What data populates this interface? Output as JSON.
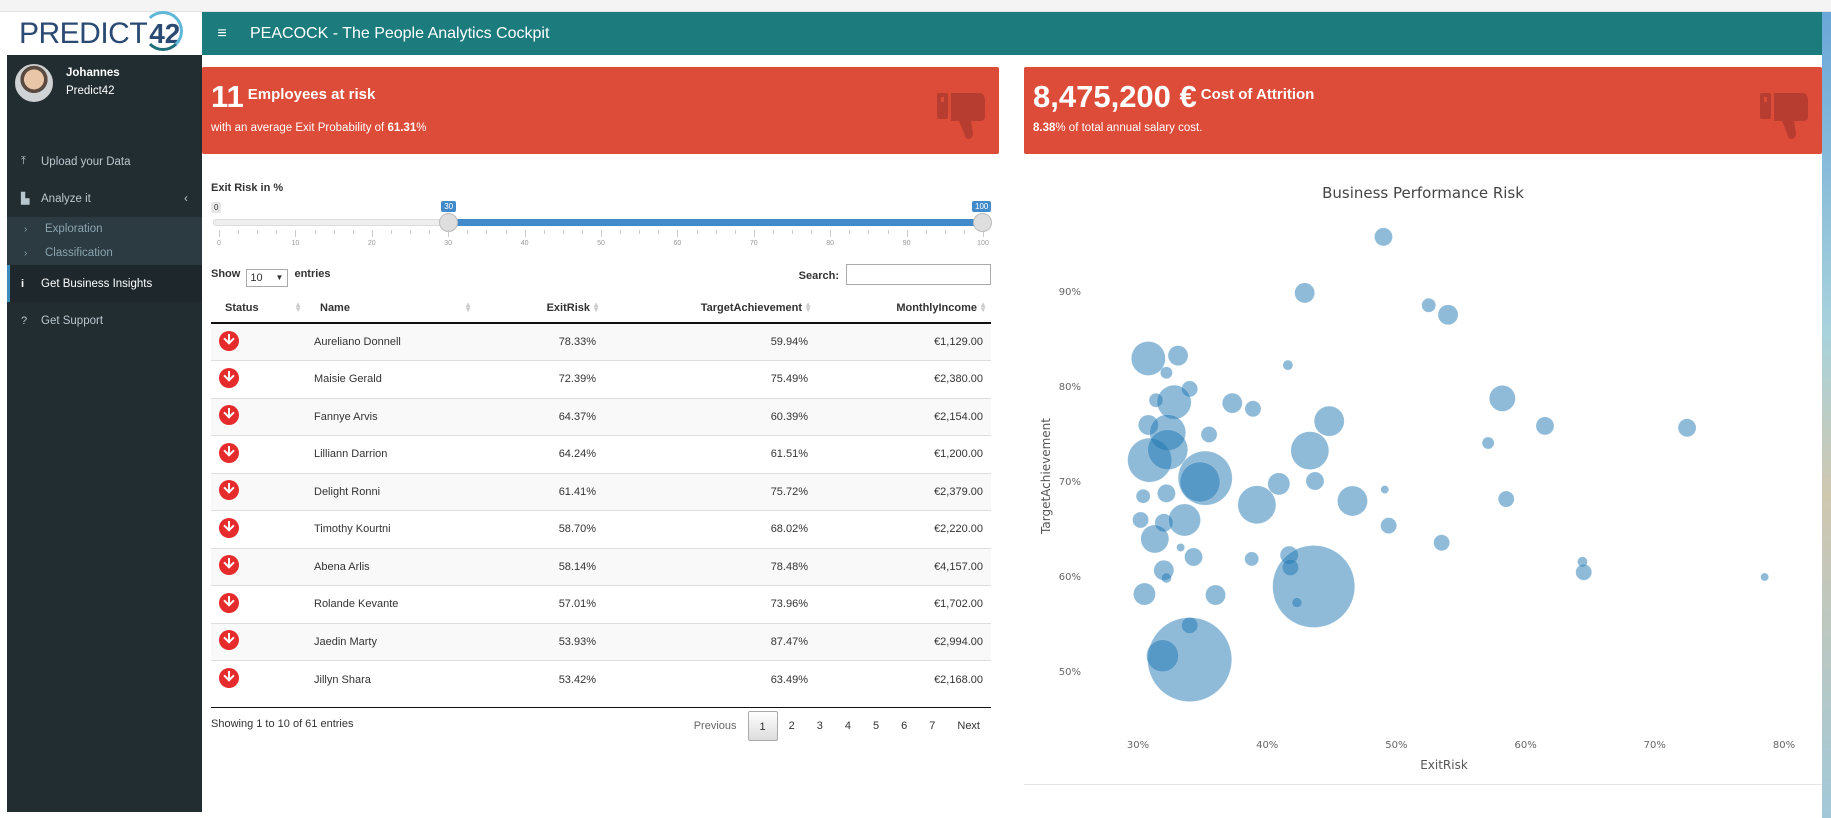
{
  "logo": {
    "text": "PREDICT",
    "number": "42"
  },
  "header": {
    "menu_icon": "≡",
    "title": "PEACOCK - The People Analytics Cockpit"
  },
  "user": {
    "name": "Johannes",
    "organization": "Predict42"
  },
  "sidebar": {
    "items": [
      {
        "label": "Upload your Data",
        "icon": "upload-icon",
        "glyph": "⤒"
      },
      {
        "label": "Analyze it",
        "icon": "area-chart-icon",
        "glyph": "▙",
        "chevron": "‹"
      },
      {
        "label": "Get Business Insights",
        "icon": "info-icon",
        "glyph": "i",
        "active": true
      },
      {
        "label": "Get Support",
        "icon": "question-icon",
        "glyph": "?"
      }
    ],
    "submenu": [
      {
        "label": "Exploration",
        "glyph": "›"
      },
      {
        "label": "Classification",
        "glyph": "›"
      }
    ]
  },
  "infoboxes": [
    {
      "value": "11",
      "title": "Employees at risk",
      "sub_prefix": "with an average Exit Probability of ",
      "sub_bold": "61.31",
      "sub_suffix": "%",
      "icon": "thumbs-down-icon"
    },
    {
      "value": "8,475,200 €",
      "title": "Cost of Attrition",
      "sub_prefix": "",
      "sub_bold": "8.38",
      "sub_suffix": "% of total annual salary cost.",
      "icon": "thumbs-down-icon"
    }
  ],
  "colors": {
    "header": "#1b7b7d",
    "sidebar": "#222d32",
    "danger": "#dd4b39",
    "slider": "#428bca",
    "bubble": "#1f77b4"
  },
  "slider": {
    "label": "Exit Risk in %",
    "min": 0,
    "max": 100,
    "from": 30,
    "to": 100,
    "min_label": "0",
    "from_label": "30",
    "to_label": "100",
    "ticks": [
      "0",
      "10",
      "20",
      "30",
      "40",
      "50",
      "60",
      "70",
      "80",
      "90",
      "100"
    ]
  },
  "table": {
    "length_label_before": "Show",
    "length_value": "10",
    "length_label_after": "entries",
    "search_label": "Search:",
    "search_value": "",
    "columns": [
      "Status",
      "Name",
      "ExitRisk",
      "TargetAchievement",
      "MonthlyIncome"
    ],
    "rows": [
      {
        "status": "down",
        "name": "Aureliano Donnell",
        "exit_risk": "78.33%",
        "target": "59.94%",
        "income": "€1,129.00"
      },
      {
        "status": "down",
        "name": "Maisie Gerald",
        "exit_risk": "72.39%",
        "target": "75.49%",
        "income": "€2,380.00"
      },
      {
        "status": "down",
        "name": "Fannye Arvis",
        "exit_risk": "64.37%",
        "target": "60.39%",
        "income": "€2,154.00"
      },
      {
        "status": "down",
        "name": "Lilliann Darrion",
        "exit_risk": "64.24%",
        "target": "61.51%",
        "income": "€1,200.00"
      },
      {
        "status": "down",
        "name": "Delight Ronni",
        "exit_risk": "61.41%",
        "target": "75.72%",
        "income": "€2,379.00"
      },
      {
        "status": "down",
        "name": "Timothy Kourtni",
        "exit_risk": "58.70%",
        "target": "68.02%",
        "income": "€2,220.00"
      },
      {
        "status": "down",
        "name": "Abena Arlis",
        "exit_risk": "58.14%",
        "target": "78.48%",
        "income": "€4,157.00"
      },
      {
        "status": "down",
        "name": "Rolande Kevante",
        "exit_risk": "57.01%",
        "target": "73.96%",
        "income": "€1,702.00"
      },
      {
        "status": "down",
        "name": "Jaedin Marty",
        "exit_risk": "53.93%",
        "target": "87.47%",
        "income": "€2,994.00"
      },
      {
        "status": "down",
        "name": "Jillyn Shara",
        "exit_risk": "53.42%",
        "target": "63.49%",
        "income": "€2,168.00"
      }
    ],
    "info": "Showing 1 to 10 of 61 entries",
    "pagination": {
      "previous": "Previous",
      "pages": [
        "1",
        "2",
        "3",
        "4",
        "5",
        "6",
        "7"
      ],
      "current": "1",
      "next": "Next"
    }
  },
  "chart_data": {
    "type": "scatter",
    "title": "Business Performance Risk",
    "xlabel": "ExitRisk",
    "ylabel": "TargetAchievement",
    "xlim": [
      25.5,
      82
    ],
    "ylim": [
      41,
      99
    ],
    "xticks": [
      30,
      40,
      50,
      60,
      70,
      80
    ],
    "xtick_labels": [
      "30%",
      "40%",
      "50%",
      "60%",
      "70%",
      "80%"
    ],
    "yticks": [
      50,
      60,
      70,
      80,
      90
    ],
    "ytick_labels": [
      "50%",
      "60%",
      "70%",
      "80%",
      "90%"
    ],
    "grid": false,
    "legend": "none",
    "size_encoding": "relative bubble size (approx.)",
    "points": [
      {
        "x": 49.0,
        "y": 95.7,
        "size": 9
      },
      {
        "x": 42.9,
        "y": 89.8,
        "size": 10
      },
      {
        "x": 52.5,
        "y": 88.5,
        "size": 7
      },
      {
        "x": 54.0,
        "y": 87.5,
        "size": 10
      },
      {
        "x": 30.8,
        "y": 82.9,
        "size": 17
      },
      {
        "x": 33.1,
        "y": 83.2,
        "size": 10
      },
      {
        "x": 32.2,
        "y": 81.4,
        "size": 6
      },
      {
        "x": 41.6,
        "y": 82.2,
        "size": 5
      },
      {
        "x": 34.0,
        "y": 79.7,
        "size": 8
      },
      {
        "x": 32.8,
        "y": 78.3,
        "size": 17
      },
      {
        "x": 31.4,
        "y": 78.5,
        "size": 7
      },
      {
        "x": 37.3,
        "y": 78.2,
        "size": 10
      },
      {
        "x": 38.9,
        "y": 77.6,
        "size": 8
      },
      {
        "x": 44.8,
        "y": 76.3,
        "size": 15
      },
      {
        "x": 58.2,
        "y": 78.7,
        "size": 13
      },
      {
        "x": 61.5,
        "y": 75.8,
        "size": 9
      },
      {
        "x": 72.5,
        "y": 75.6,
        "size": 9
      },
      {
        "x": 57.1,
        "y": 74.0,
        "size": 6
      },
      {
        "x": 30.8,
        "y": 75.9,
        "size": 10
      },
      {
        "x": 32.3,
        "y": 75.1,
        "size": 18
      },
      {
        "x": 35.5,
        "y": 74.9,
        "size": 8
      },
      {
        "x": 30.9,
        "y": 72.2,
        "size": 22
      },
      {
        "x": 32.3,
        "y": 73.3,
        "size": 20
      },
      {
        "x": 43.3,
        "y": 73.2,
        "size": 19
      },
      {
        "x": 35.2,
        "y": 70.3,
        "size": 27
      },
      {
        "x": 34.8,
        "y": 69.9,
        "size": 20
      },
      {
        "x": 40.9,
        "y": 69.7,
        "size": 11
      },
      {
        "x": 43.7,
        "y": 70.0,
        "size": 9
      },
      {
        "x": 39.2,
        "y": 67.5,
        "size": 19
      },
      {
        "x": 46.6,
        "y": 67.9,
        "size": 15
      },
      {
        "x": 49.1,
        "y": 69.1,
        "size": 4
      },
      {
        "x": 30.4,
        "y": 68.4,
        "size": 7
      },
      {
        "x": 32.2,
        "y": 68.7,
        "size": 9
      },
      {
        "x": 58.5,
        "y": 68.1,
        "size": 8
      },
      {
        "x": 30.2,
        "y": 65.9,
        "size": 8
      },
      {
        "x": 32.0,
        "y": 65.6,
        "size": 9
      },
      {
        "x": 33.6,
        "y": 65.9,
        "size": 16
      },
      {
        "x": 31.3,
        "y": 63.9,
        "size": 14
      },
      {
        "x": 49.4,
        "y": 65.3,
        "size": 8
      },
      {
        "x": 53.5,
        "y": 63.5,
        "size": 8
      },
      {
        "x": 33.3,
        "y": 63.0,
        "size": 4
      },
      {
        "x": 34.3,
        "y": 62.0,
        "size": 9
      },
      {
        "x": 38.8,
        "y": 61.8,
        "size": 7
      },
      {
        "x": 41.7,
        "y": 62.2,
        "size": 9
      },
      {
        "x": 41.8,
        "y": 60.9,
        "size": 8
      },
      {
        "x": 32.0,
        "y": 60.6,
        "size": 10
      },
      {
        "x": 32.2,
        "y": 59.8,
        "size": 5
      },
      {
        "x": 64.4,
        "y": 61.5,
        "size": 5
      },
      {
        "x": 64.5,
        "y": 60.4,
        "size": 8
      },
      {
        "x": 78.5,
        "y": 59.9,
        "size": 4
      },
      {
        "x": 43.6,
        "y": 58.9,
        "size": 41
      },
      {
        "x": 30.5,
        "y": 58.1,
        "size": 11
      },
      {
        "x": 36.0,
        "y": 58.0,
        "size": 10
      },
      {
        "x": 42.3,
        "y": 57.2,
        "size": 5
      },
      {
        "x": 34.0,
        "y": 54.8,
        "size": 8
      },
      {
        "x": 34.0,
        "y": 51.2,
        "size": 42
      },
      {
        "x": 31.9,
        "y": 51.6,
        "size": 16
      }
    ]
  }
}
